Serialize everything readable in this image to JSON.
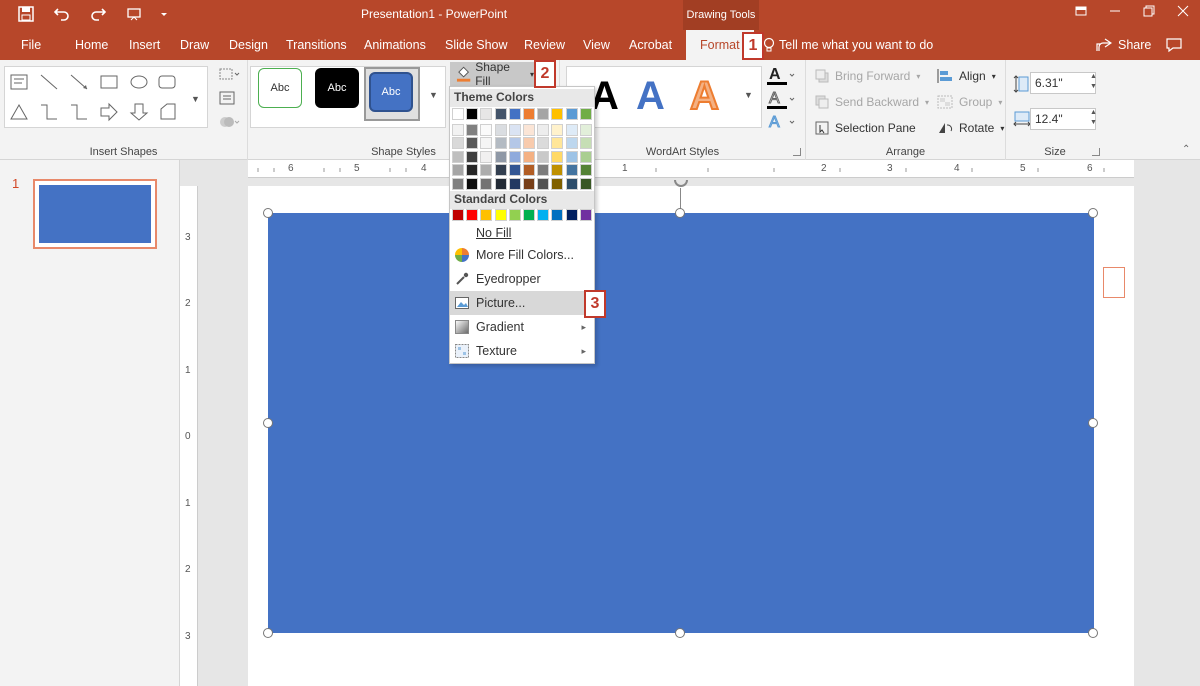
{
  "titlebar": {
    "title": "Presentation1  -  PowerPoint",
    "context_tab": "Drawing Tools"
  },
  "tabs": [
    {
      "label": "File"
    },
    {
      "label": "Home"
    },
    {
      "label": "Insert"
    },
    {
      "label": "Draw"
    },
    {
      "label": "Design"
    },
    {
      "label": "Transitions"
    },
    {
      "label": "Animations"
    },
    {
      "label": "Slide Show"
    },
    {
      "label": "Review"
    },
    {
      "label": "View"
    },
    {
      "label": "Acrobat"
    },
    {
      "label": "Format"
    }
  ],
  "tell_me": "Tell me what you want to do",
  "share": "Share",
  "ribbon": {
    "groups": {
      "insert_shapes": "Insert Shapes",
      "shape_styles": "Shape Styles",
      "wordart_styles": "WordArt Styles",
      "arrange": "Arrange",
      "size": "Size"
    },
    "style_samples": [
      "Abc",
      "Abc",
      "Abc"
    ],
    "shape_fill": "Shape Fill",
    "wordart_letter": "A",
    "arrange": {
      "bring_forward": "Bring Forward",
      "send_backward": "Send Backward",
      "selection_pane": "Selection Pane",
      "align": "Align",
      "group": "Group",
      "rotate": "Rotate"
    },
    "size": {
      "height": "6.31\"",
      "width": "12.4\""
    }
  },
  "slides": {
    "number": "1"
  },
  "ruler_h": [
    "6",
    "5",
    "4",
    "1",
    "2",
    "3",
    "4",
    "5",
    "6"
  ],
  "ruler_v": [
    "3",
    "2",
    "1",
    "0",
    "1",
    "2",
    "3"
  ],
  "dropdown": {
    "theme_colors_label": "Theme Colors",
    "standard_colors_label": "Standard Colors",
    "no_fill": "No Fill",
    "more_fill_colors": "More Fill Colors...",
    "eyedropper": "Eyedropper",
    "picture": "Picture...",
    "gradient": "Gradient",
    "texture": "Texture"
  },
  "callouts": [
    "1",
    "2",
    "3"
  ],
  "colors": {
    "accent": "#b7472a",
    "shape_fill": "#4472c4",
    "theme_top": [
      "#ffffff",
      "#000000",
      "#e7e6e6",
      "#44546a",
      "#4472c4",
      "#ed7d31",
      "#a5a5a5",
      "#ffc000",
      "#5b9bd5",
      "#70ad47"
    ],
    "standard": [
      "#c00000",
      "#ff0000",
      "#ffc000",
      "#ffff00",
      "#92d050",
      "#00b050",
      "#00b0f0",
      "#0070c0",
      "#002060",
      "#7030a0"
    ]
  }
}
